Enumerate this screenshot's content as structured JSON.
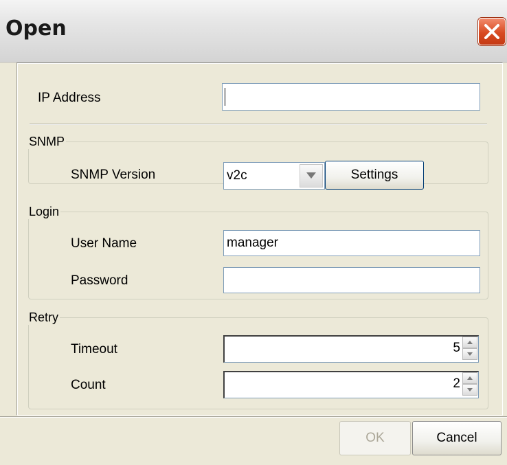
{
  "window": {
    "title": "Open",
    "close_icon": "close-x-icon",
    "close_color": "#d84a22"
  },
  "ip": {
    "label": "IP Address",
    "value": ""
  },
  "snmp": {
    "group_label": "SNMP",
    "version_label": "SNMP Version",
    "version_value": "v2c",
    "settings_label": "Settings"
  },
  "login": {
    "group_label": "Login",
    "username_label": "User Name",
    "username_value": "manager",
    "password_label": "Password",
    "password_value": ""
  },
  "retry": {
    "group_label": "Retry",
    "timeout_label": "Timeout",
    "timeout_value": "5",
    "count_label": "Count",
    "count_value": "2"
  },
  "buttons": {
    "ok_label": "OK",
    "cancel_label": "Cancel"
  }
}
